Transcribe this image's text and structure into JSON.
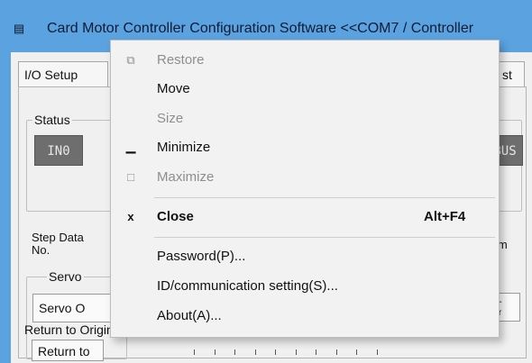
{
  "window": {
    "title": "Card Motor Controller Configuration Software <<COM7 / Controller",
    "icon": "app-icon",
    "icon_glyph": "▤"
  },
  "tabs": [
    {
      "label": "I/O Setup"
    },
    {
      "label": "st"
    }
  ],
  "status_group": {
    "label": "Status",
    "in0_label": "IN0",
    "bus_label": "BUS"
  },
  "step_data": {
    "label_line1": "Step Data",
    "label_line2": "No."
  },
  "unit_label": "mm",
  "servo_group": {
    "label": "Servo",
    "button_label": "Servo O"
  },
  "right_small": {
    "dash": "-",
    "text": "ector"
  },
  "return_to_origin": {
    "label": "Return to Origin",
    "button_label": "Return to"
  },
  "system_menu": {
    "items": [
      {
        "label": "Restore",
        "glyph": "⧉",
        "icon": "restore-icon",
        "enabled": false
      },
      {
        "label": "Move",
        "glyph": "",
        "icon": "",
        "enabled": true
      },
      {
        "label": "Size",
        "glyph": "",
        "icon": "",
        "enabled": false
      },
      {
        "label": "Minimize",
        "glyph": "▁",
        "icon": "minimize-icon",
        "enabled": true
      },
      {
        "label": "Maximize",
        "glyph": "□",
        "icon": "maximize-icon",
        "enabled": false
      },
      {
        "label": "Close",
        "glyph": "x",
        "icon": "close-icon",
        "enabled": true,
        "bold": true,
        "accelerator": "Alt+F4"
      },
      {
        "label": "Password(P)...",
        "enabled": true
      },
      {
        "label": "ID/communication setting(S)...",
        "enabled": true
      },
      {
        "label": "About(A)...",
        "enabled": true
      }
    ]
  },
  "colors": {
    "titlebar": "#5aa3e0",
    "menu_bg": "#f2f2f2",
    "disabled_text": "#8e8e8e",
    "io_button": "#6e6e6e"
  }
}
